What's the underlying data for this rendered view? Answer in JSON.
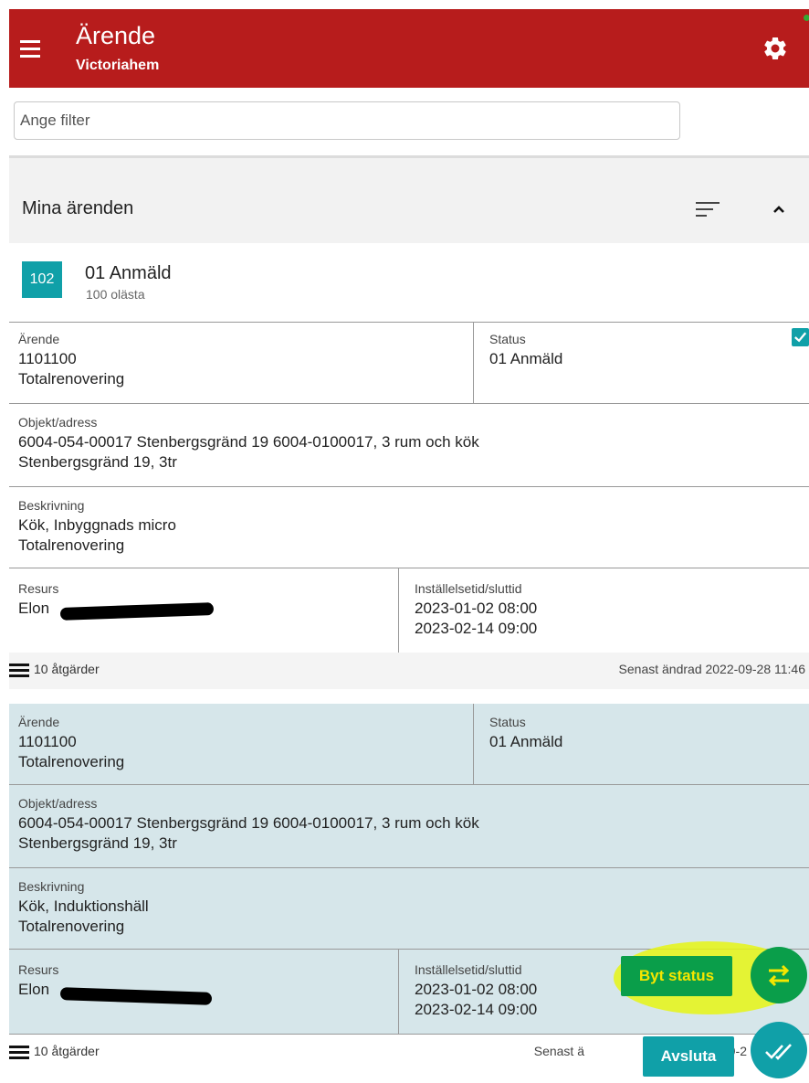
{
  "header": {
    "title": "Ärende",
    "subtitle": "Victoriahem",
    "menu_icon": "hamburger-menu-icon",
    "settings_icon": "gear-icon"
  },
  "filter": {
    "placeholder": "Ange filter",
    "value": ""
  },
  "section": {
    "label": "Mina ärenden",
    "sort_icon": "sort-icon",
    "collapse_icon": "chevron-up-icon"
  },
  "group": {
    "badge": "102",
    "title": "01 Anmäld",
    "unread": "100 olästa"
  },
  "cards": [
    {
      "arende_label": "Ärende",
      "arende_number": "1101100",
      "arende_type": "Totalrenovering",
      "status_label": "Status",
      "status_value": "01 Anmäld",
      "objekt_label": "Objekt/adress",
      "objekt_line1": "6004-054-00017 Stenbergsgränd 19 6004-0100017, 3 rum och kök",
      "objekt_line2": "Stenbergsgränd 19, 3tr",
      "beskrivning_label": "Beskrivning",
      "beskrivning_line1": "Kök, Inbyggnads micro",
      "beskrivning_line2": "Totalrenovering",
      "resurs_label": "Resurs",
      "resurs_value": "Elon",
      "time_label": "Inställelsetid/sluttid",
      "time_start": "2023-01-02 08:00",
      "time_end": "2023-02-14 09:00",
      "actions": "10 åtgärder",
      "updated": "Senast ändrad 2022-09-28 11:46",
      "selected": true
    },
    {
      "arende_label": "Ärende",
      "arende_number": "1101100",
      "arende_type": "Totalrenovering",
      "status_label": "Status",
      "status_value": "01 Anmäld",
      "objekt_label": "Objekt/adress",
      "objekt_line1": "6004-054-00017 Stenbergsgränd 19 6004-0100017, 3 rum och kök",
      "objekt_line2": "Stenbergsgränd 19, 3tr",
      "beskrivning_label": "Beskrivning",
      "beskrivning_line1": "Kök, Induktionshäll",
      "beskrivning_line2": "Totalrenovering",
      "resurs_label": "Resurs",
      "resurs_value": "Elon",
      "time_label": "Inställelsetid/sluttid",
      "time_start": "2023-01-02 08:00",
      "time_end": "2023-02-14 09:00",
      "actions": "10 åtgärder",
      "updated": "Senast ä",
      "updated_tail": "9-2"
    }
  ],
  "actions": {
    "change_status": "Byt status",
    "finish": "Avsluta",
    "swap_icon": "swap-arrows-icon",
    "done_icon": "double-check-icon"
  },
  "colors": {
    "appbar": "#b71c1c",
    "teal": "#10a0a8",
    "green": "#0a9e4a",
    "highlight": "#e6f514",
    "selected_card": "#d6e6ea"
  }
}
